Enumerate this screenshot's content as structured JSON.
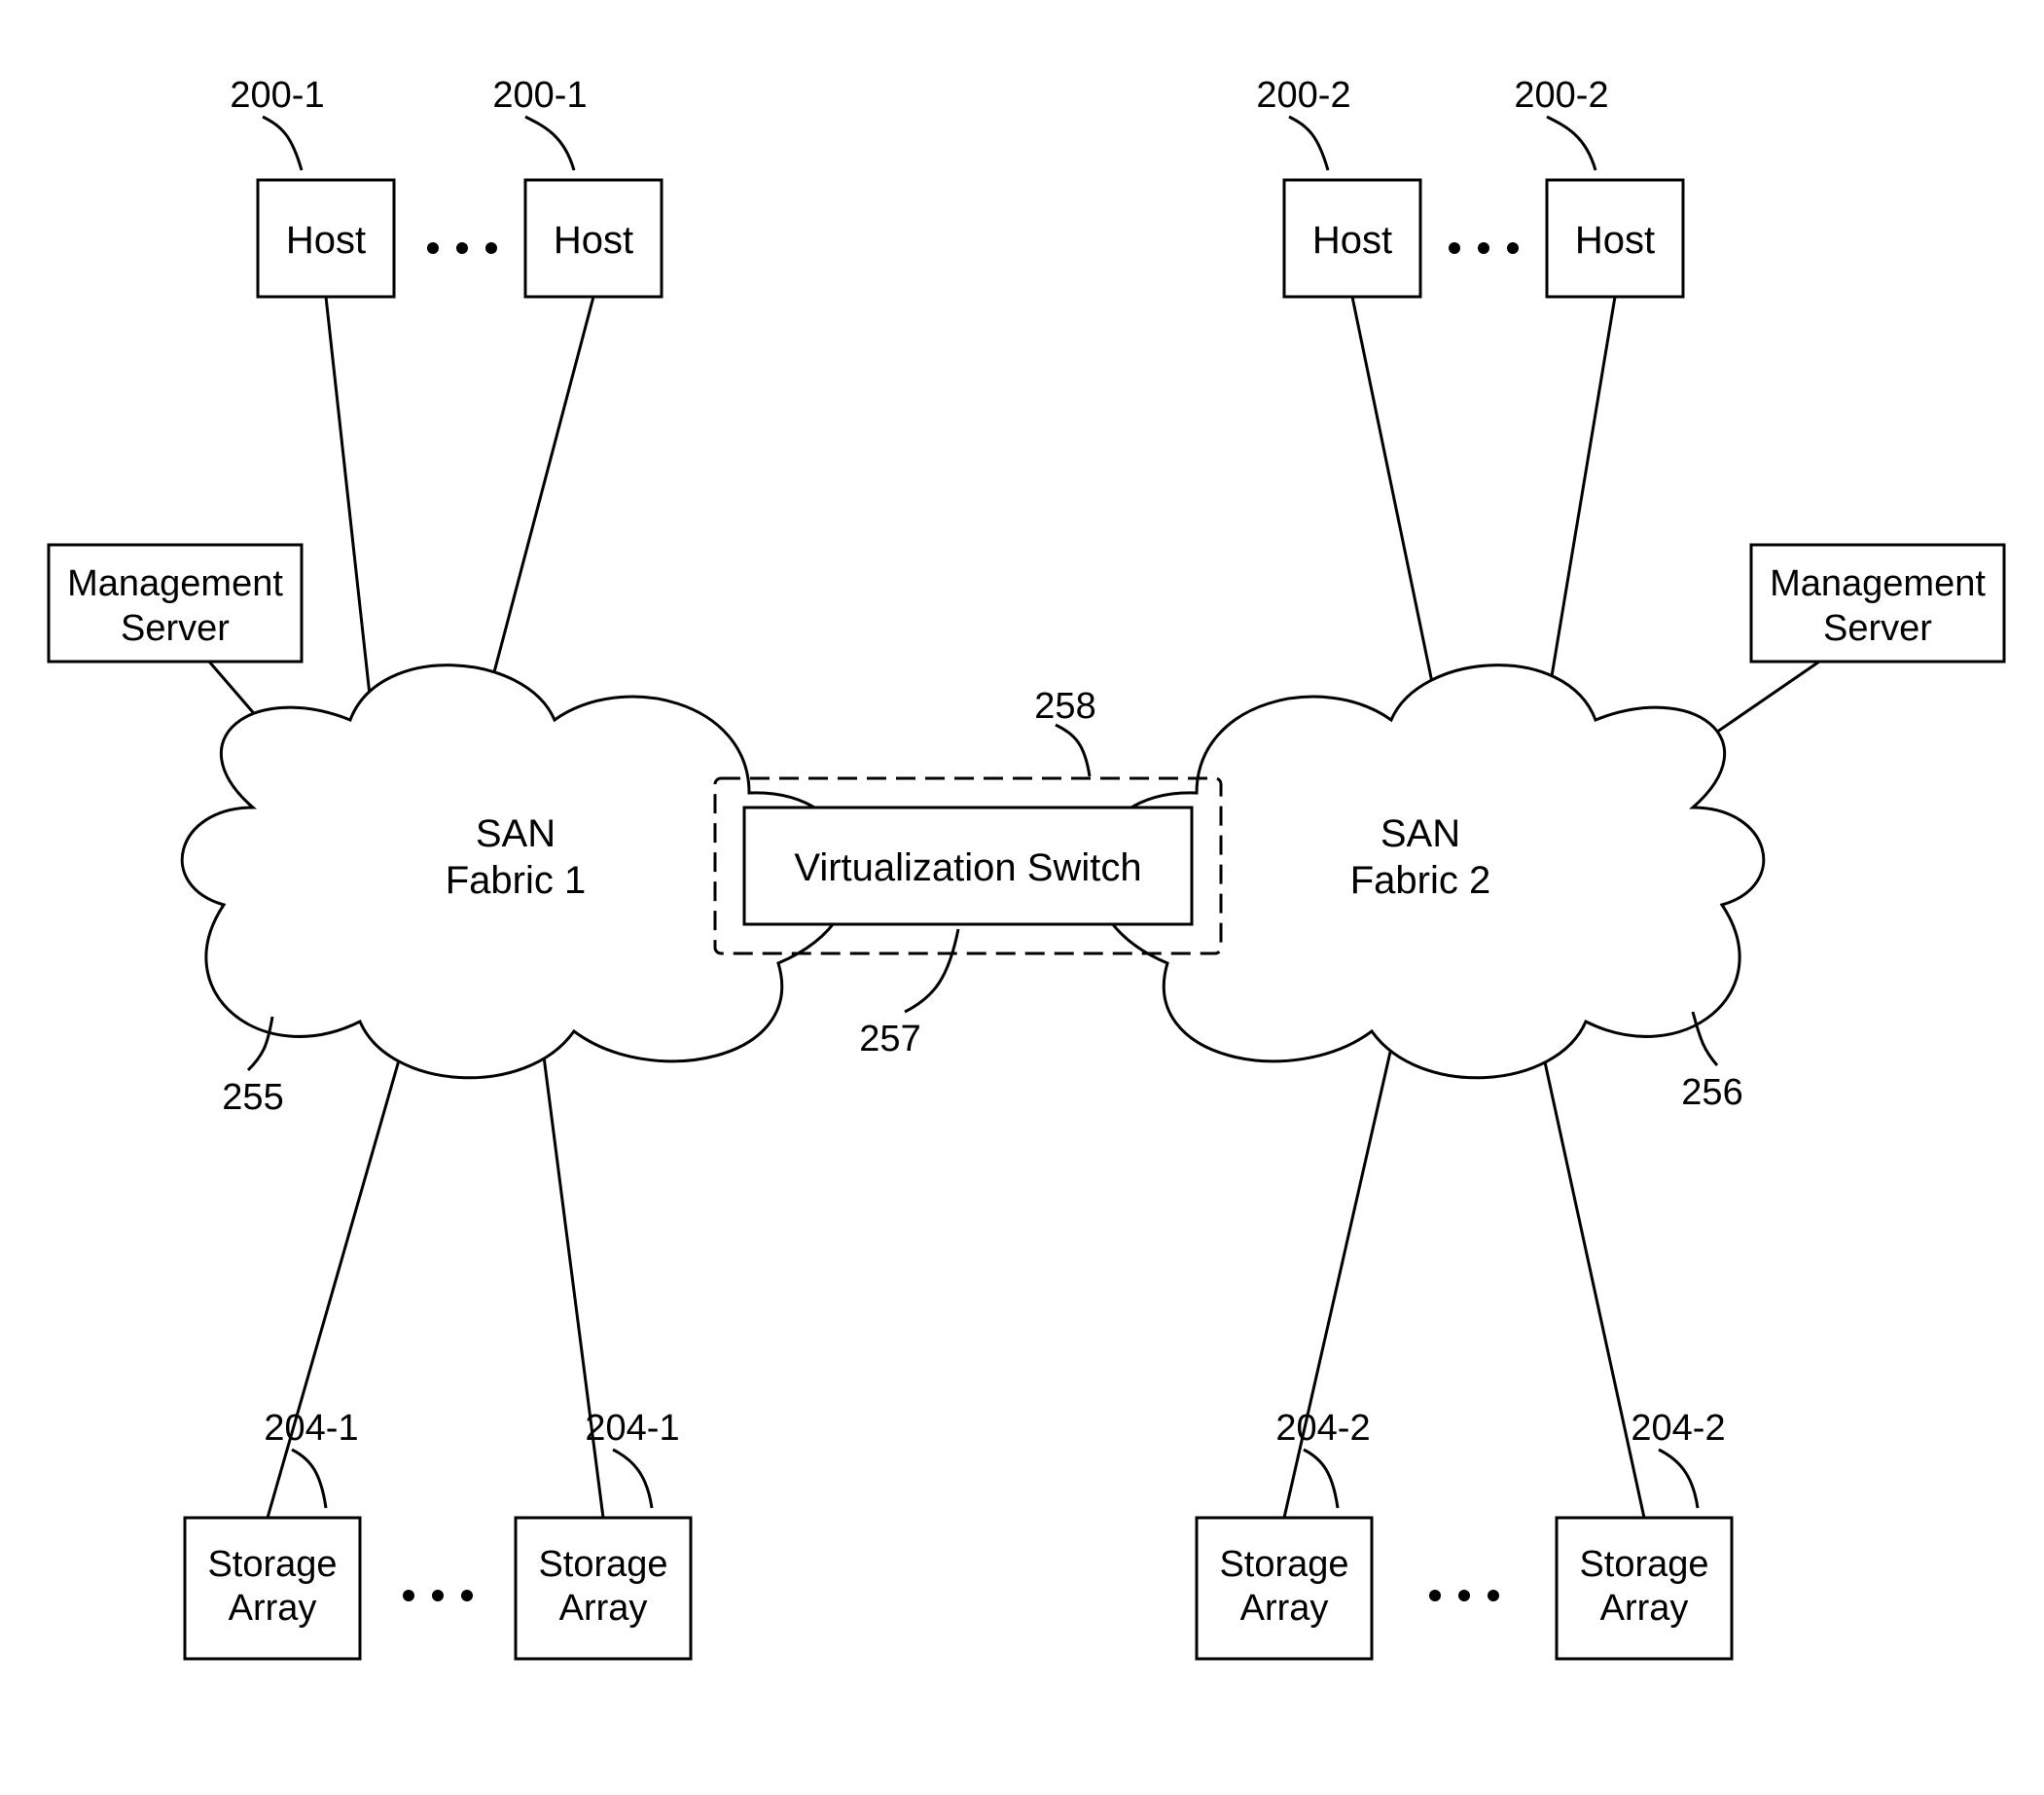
{
  "hosts": {
    "group1": {
      "label_a": "Host",
      "label_b": "Host",
      "ref_a": "200-1",
      "ref_b": "200-1"
    },
    "group2": {
      "label_a": "Host",
      "label_b": "Host",
      "ref_a": "200-2",
      "ref_b": "200-2"
    }
  },
  "mgmt": {
    "left": {
      "line1": "Management",
      "line2": "Server"
    },
    "right": {
      "line1": "Management",
      "line2": "Server"
    }
  },
  "fabrics": {
    "left": {
      "line1": "SAN",
      "line2": "Fabric 1",
      "ref": "255"
    },
    "right": {
      "line1": "SAN",
      "line2": "Fabric 2",
      "ref": "256"
    }
  },
  "switch": {
    "label": "Virtualization Switch",
    "ref_inner": "257",
    "ref_outer": "258"
  },
  "storage": {
    "group1": {
      "line1": "Storage",
      "line2": "Array",
      "ref_a": "204-1",
      "ref_b": "204-1"
    },
    "group2": {
      "line1": "Storage",
      "line2": "Array",
      "ref_a": "204-2",
      "ref_b": "204-2"
    }
  }
}
